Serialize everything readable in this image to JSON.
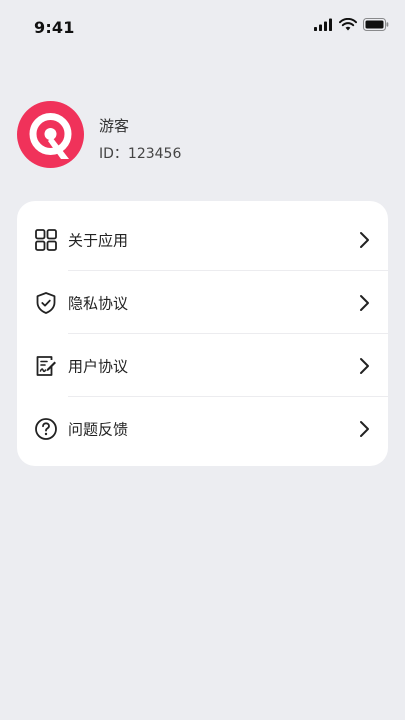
{
  "status_bar": {
    "time": "9:41",
    "icons": [
      "signal-icon",
      "wifi-icon",
      "battery-icon"
    ]
  },
  "profile": {
    "name": "游客",
    "id_text": "ID：123456",
    "avatar_icon": "app-logo-icon",
    "avatar_color": "#f0325a"
  },
  "menu": {
    "items": [
      {
        "label": "关于应用",
        "icon": "grid-apps-icon"
      },
      {
        "label": "隐私协议",
        "icon": "shield-check-icon"
      },
      {
        "label": "用户协议",
        "icon": "document-edit-icon"
      },
      {
        "label": "问题反馈",
        "icon": "question-circle-icon"
      }
    ]
  },
  "colors": {
    "background": "#ecedf1",
    "card": "#ffffff",
    "accent": "#f0325a"
  }
}
